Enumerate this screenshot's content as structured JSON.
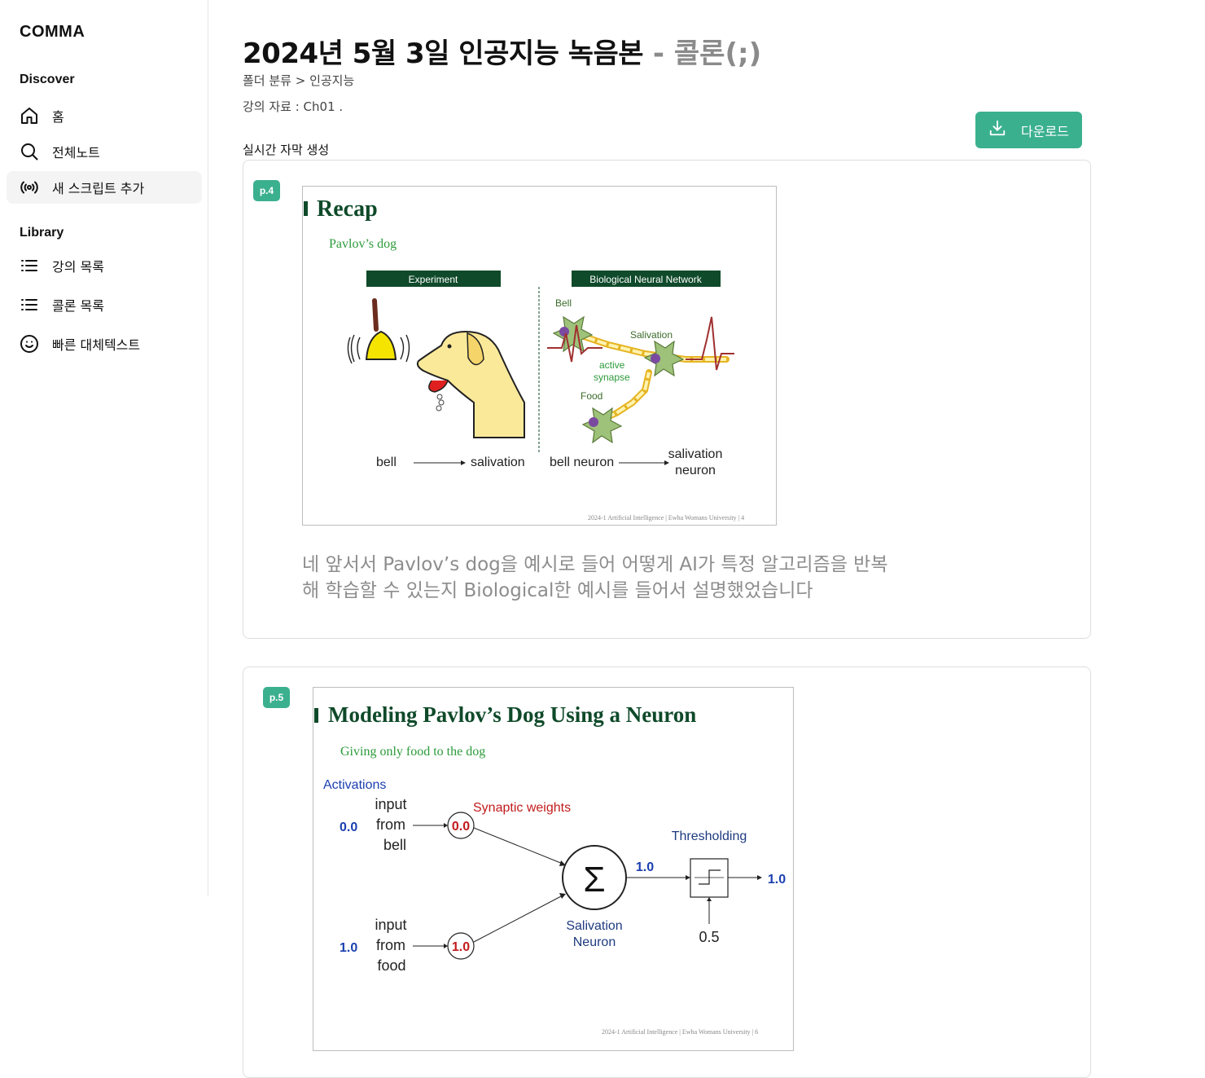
{
  "sidebar": {
    "brand": "COMMA",
    "discover_title": "Discover",
    "discover_items": [
      {
        "label": "홈",
        "icon": "home-icon"
      },
      {
        "label": "전체노트",
        "icon": "search-icon"
      },
      {
        "label": "새 스크립트 추가",
        "icon": "broadcast-icon"
      }
    ],
    "library_title": "Library",
    "library_items": [
      {
        "label": "강의 목록",
        "icon": "list-icon"
      },
      {
        "label": "콜론 목록",
        "icon": "list-icon"
      },
      {
        "label": "빠른 대체텍스트",
        "icon": "smiley-icon"
      }
    ]
  },
  "header": {
    "title": "2024년 5월 3일 인공지능 녹음본",
    "title_suffix": " - 콜론(;)",
    "breadcrumb": "폴더 분류 > 인공지능",
    "material": "강의 자료 : Ch01 .",
    "live_label": "실시간 자막 생성",
    "download_label": "다운로드"
  },
  "cards": [
    {
      "badge": "p.4",
      "slide": {
        "title": "Recap",
        "subtitle": "Pavlov’s dog",
        "left_box": "Experiment",
        "right_box": "Biological Neural Network",
        "labels": {
          "bell_tag": "Bell",
          "salivation_tag": "Salivation",
          "active_synapse_1": "active",
          "active_synapse_2": "synapse",
          "food_tag": "Food",
          "bottom_bell": "bell",
          "bottom_salivation": "salivation",
          "bottom_bell_neuron": "bell neuron",
          "bottom_salivation_neuron_1": "salivation",
          "bottom_salivation_neuron_2": "neuron"
        },
        "footer": "2024-1 Artificial Intelligence | Ewha Womans University | 4"
      },
      "transcript": "네 앞서서 Pavlov’s dog을 예시로 들어 어떻게 AI가 특정 알고리즘을 반복해 학습할 수 있는지 Biological한 예시를 들어서 설명했었습니다"
    },
    {
      "badge": "p.5",
      "slide": {
        "title": "Modeling Pavlov’s Dog Using a Neuron",
        "subtitle": "Giving only food to the dog",
        "labels": {
          "activations": "Activations",
          "input_bell_1": "input",
          "input_bell_2": "from",
          "input_bell_3": "bell",
          "input_food_1": "input",
          "input_food_2": "from",
          "input_food_3": "food",
          "act_bell": "0.0",
          "act_food": "1.0",
          "synaptic_weights": "Synaptic weights",
          "w_bell": "0.0",
          "w_food": "1.0",
          "sigma": "Σ",
          "sum_out": "1.0",
          "neuron_1": "Salivation",
          "neuron_2": "Neuron",
          "thresholding": "Thresholding",
          "threshold": "0.5",
          "output": "1.0"
        },
        "footer": "2024-1 Artificial Intelligence | Ewha Womans University | 6"
      }
    }
  ],
  "colors": {
    "accent": "#3bb08f",
    "slide_green": "#0f4a2a",
    "blue": "#1a3fb0",
    "red": "#c21b1b"
  }
}
